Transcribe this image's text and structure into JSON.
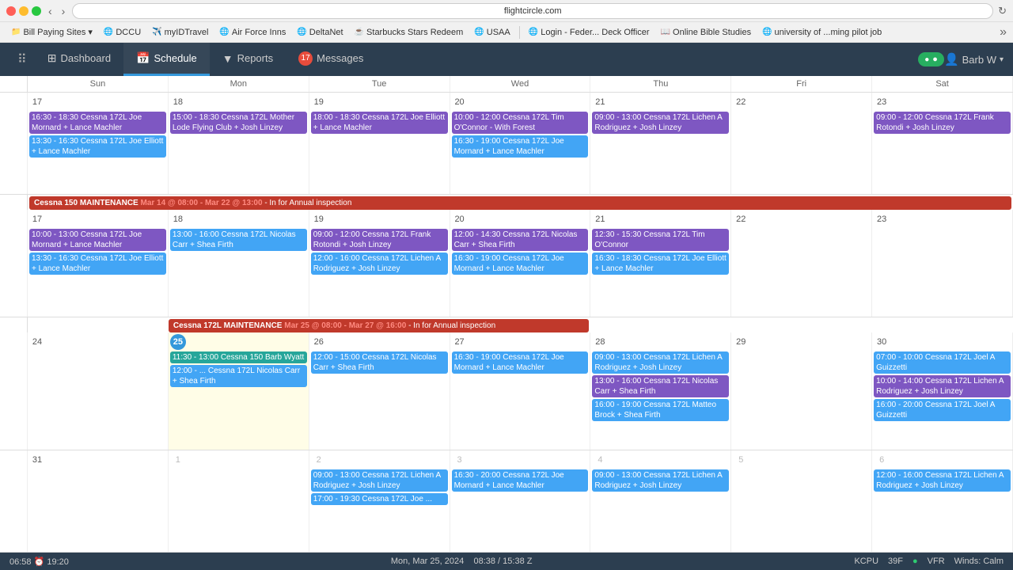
{
  "browser": {
    "url": "flightcircle.com",
    "bookmarks": [
      {
        "label": "Bill Paying Sites",
        "icon": "📁",
        "hasDropdown": true
      },
      {
        "label": "DCCU",
        "icon": "🌐"
      },
      {
        "label": "myIDTravel",
        "icon": "✈️"
      },
      {
        "label": "Air Force Inns",
        "icon": "🌐"
      },
      {
        "label": "DeltaNet",
        "icon": "🌐"
      },
      {
        "label": "Starbucks Stars Redeem",
        "icon": "☕"
      },
      {
        "label": "USAA",
        "icon": "🌐"
      },
      {
        "label": "Login - Feder... Deck Officer",
        "icon": "🌐"
      },
      {
        "label": "Online Bible Studies",
        "icon": "📖"
      },
      {
        "label": "university of ...ming pilot job",
        "icon": "🌐"
      }
    ]
  },
  "nav": {
    "dashboard_label": "Dashboard",
    "schedule_label": "Schedule",
    "reports_label": "Reports",
    "messages_label": "Messages",
    "message_count": "17",
    "user_name": "Barb W"
  },
  "calendar": {
    "day_headers": [
      "",
      "Sun",
      "Mon",
      "Tue",
      "Wed",
      "Thu",
      "Fri",
      "Sat"
    ],
    "week1": {
      "week_num": "",
      "days": [
        {
          "num": "17",
          "events": [
            {
              "text": "16:30 - 18:30 Cessna 172L Joe Mornard + Lance Machler",
              "color": "purple"
            },
            {
              "text": "13:30 - 16:30 Cessna 172L Joe Elliott + Lance Machler",
              "color": "blue"
            }
          ]
        },
        {
          "num": "18",
          "events": [
            {
              "text": "15:00 - 18:30 Cessna 172L Mother Lode Flying Club + Josh Linzey",
              "color": "purple"
            }
          ]
        },
        {
          "num": "19",
          "events": [
            {
              "text": "18:00 - 18:30 Cessna 172L Joe Elliott + Lance Machler",
              "color": "purple"
            }
          ]
        },
        {
          "num": "20",
          "events": [
            {
              "text": "10:00 - 12:00 Cessna 172L Tim O'Connor - With Forest",
              "color": "purple"
            },
            {
              "text": "16:30 - 19:00 Cessna 172L Joe Mornard + Lance Machler",
              "color": "blue"
            }
          ]
        },
        {
          "num": "21",
          "events": [
            {
              "text": "09:00 - 13:00 Cessna 172L Lichen A Rodriguez + Josh Linzey",
              "color": "purple"
            }
          ]
        },
        {
          "num": "22",
          "events": []
        },
        {
          "num": "23",
          "events": [
            {
              "text": "09:00 - 12:00 Cessna 172L Frank Rotondi + Josh Linzey",
              "color": "purple"
            }
          ]
        }
      ]
    },
    "week2": {
      "week_num": "",
      "maintenance": {
        "text": "Cessna 150 MAINTENANCE",
        "date_text": "Mar 14 @ 08:00 - Mar 22 @ 13:00",
        "suffix": " - In for Annual inspection",
        "color": "red",
        "span_start": 1,
        "span_end": 7
      },
      "days": [
        {
          "num": "17",
          "events": [
            {
              "text": "10:00 - 13:00 Cessna 172L Joe Mornard + Lance Machler",
              "color": "purple"
            },
            {
              "text": "13:30 - 16:30 Cessna 172L Joe Elliott + Lance Machler",
              "color": "blue"
            }
          ]
        },
        {
          "num": "18",
          "events": [
            {
              "text": "13:00 - 16:00 Cessna 172L Nicolas Carr + Shea Firth",
              "color": "blue"
            }
          ]
        },
        {
          "num": "19",
          "events": [
            {
              "text": "09:00 - 12:00 Cessna 172L Frank Rotondi + Josh Linzey",
              "color": "purple"
            },
            {
              "text": "12:00 - 16:00 Cessna 172L Lichen A Rodriguez + Josh Linzey",
              "color": "blue"
            }
          ]
        },
        {
          "num": "20",
          "events": [
            {
              "text": "12:00 - 14:30 Cessna 172L Nicolas Carr + Shea Firth",
              "color": "purple"
            },
            {
              "text": "16:30 - 19:00 Cessna 172L Joe Mornard + Lance Machler",
              "color": "blue"
            }
          ]
        },
        {
          "num": "21",
          "events": [
            {
              "text": "12:30 - 15:30 Cessna 172L Tim O'Connor",
              "color": "purple"
            },
            {
              "text": "16:30 - 18:30 Cessna 172L Joe Elliott + Lance Machler",
              "color": "blue"
            }
          ]
        },
        {
          "num": "22",
          "events": []
        },
        {
          "num": "23",
          "events": []
        }
      ]
    },
    "week3": {
      "week_num": "",
      "maintenance_172L": {
        "text": "Cessna 172L MAINTENANCE",
        "date_text": "Mar 25 @ 08:00 - Mar 27 @ 16:00",
        "suffix": " - In for Annual inspection",
        "color": "red",
        "span_start": 2,
        "span_end": 4
      },
      "days": [
        {
          "num": "24",
          "events": []
        },
        {
          "num": "25",
          "today": true,
          "events": [
            {
              "text": "11:30 - 13:00 Cessna 150 Barb Wyatt",
              "color": "green"
            },
            {
              "text": "12:00 - ... Cessna 172L Nicolas Carr + Shea Firth",
              "color": "blue"
            }
          ]
        },
        {
          "num": "26",
          "events": [
            {
              "text": "12:00 - 15:00 Cessna 172L Nicolas Carr + Shea Firth",
              "color": "blue"
            }
          ]
        },
        {
          "num": "27",
          "events": [
            {
              "text": "16:30 - 19:00 Cessna 172L Joe Mornard + Lance Machler",
              "color": "blue"
            }
          ]
        },
        {
          "num": "28",
          "events": [
            {
              "text": "09:00 - 13:00 Cessna 172L Lichen A Rodriguez + Josh Linzey",
              "color": "blue"
            },
            {
              "text": "13:00 - 16:00 Cessna 172L Nicolas Carr + Shea Firth",
              "color": "purple"
            },
            {
              "text": "16:00 - 19:00 Cessna 172L Matteo Brock + Shea Firth",
              "color": "blue"
            }
          ]
        },
        {
          "num": "29",
          "events": []
        },
        {
          "num": "30",
          "events": [
            {
              "text": "07:00 - 10:00 Cessna 172L Joel A Guizzetti",
              "color": "blue"
            },
            {
              "text": "10:00 - 14:00 Cessna 172L Lichen A Rodriguez + Josh Linzey",
              "color": "purple"
            },
            {
              "text": "16:00 - 20:00 Cessna 172L Joel A Guizzetti",
              "color": "blue"
            }
          ]
        }
      ]
    },
    "week4": {
      "week_num": "",
      "days": [
        {
          "num": "31",
          "events": []
        },
        {
          "num": "1",
          "other_month": true,
          "events": []
        },
        {
          "num": "2",
          "other_month": true,
          "events": [
            {
              "text": "09:00 - 13:00 Cessna 172L Lichen A Rodriguez + Josh Linzey",
              "color": "blue"
            },
            {
              "text": "17:00 - 19:30 Cessna 172L Joe ...",
              "color": "blue"
            }
          ]
        },
        {
          "num": "3",
          "other_month": true,
          "events": [
            {
              "text": "16:30 - 20:00 Cessna 172L Joe Mornard + Lance Machler",
              "color": "blue"
            }
          ]
        },
        {
          "num": "4",
          "other_month": true,
          "events": [
            {
              "text": "09:00 - 13:00 Cessna 172L Lichen A Rodriguez + Josh Linzey",
              "color": "blue"
            }
          ]
        },
        {
          "num": "5",
          "other_month": true,
          "events": []
        },
        {
          "num": "6",
          "other_month": true,
          "events": [
            {
              "text": "12:00 - 16:00 Cessna 172L Lichen A Rodriguez + Josh Linzey",
              "color": "blue"
            }
          ]
        }
      ]
    }
  },
  "status_bar": {
    "time": "06:58",
    "status_icon": "⏰",
    "time2": "19:20",
    "center": "Mon, Mar 25, 2024",
    "zulu": "08:38 / 15:38 Z",
    "airport": "KCPU",
    "temp": "39F",
    "vfr": "VFR",
    "winds": "Winds: Calm"
  }
}
